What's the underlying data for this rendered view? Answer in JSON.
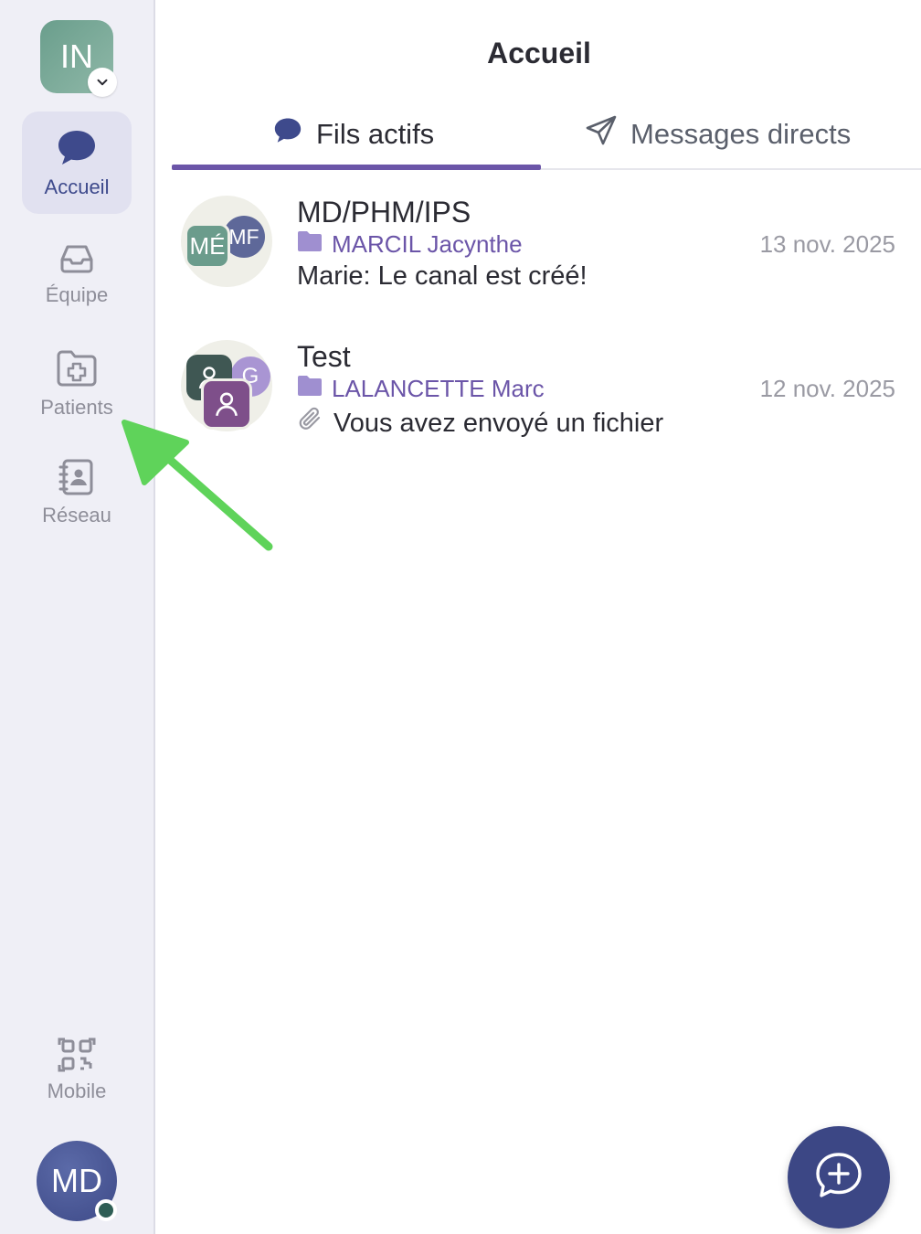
{
  "sidebar": {
    "org_initials": "IN",
    "items": [
      {
        "label": "Accueil",
        "icon": "chat-bubble-icon",
        "active": true
      },
      {
        "label": "Équipe",
        "icon": "inbox-icon",
        "active": false
      },
      {
        "label": "Patients",
        "icon": "folder-plus-icon",
        "active": false
      },
      {
        "label": "Réseau",
        "icon": "contacts-book-icon",
        "active": false
      }
    ],
    "mobile_label": "Mobile",
    "user_initials": "MD"
  },
  "header": {
    "title": "Accueil"
  },
  "tabs": [
    {
      "label": "Fils actifs",
      "icon": "chat-bubble-icon",
      "active": true
    },
    {
      "label": "Messages directs",
      "icon": "send-icon",
      "active": false
    }
  ],
  "threads": [
    {
      "title": "MD/PHM/IPS",
      "patient": "MARCIL Jacynthe",
      "date": "13 nov. 2025",
      "preview": "Marie: Le canal est créé!",
      "avatars": [
        "MÉ",
        "MF"
      ]
    },
    {
      "title": "Test",
      "patient": "LALANCETTE Marc",
      "date": "12 nov. 2025",
      "preview": "Vous avez envoyé un fichier",
      "avatars": [
        "G"
      ]
    }
  ],
  "colors": {
    "accent": "#6b55a8",
    "nav_active": "#3e4a8c",
    "fab": "#3c4785",
    "annotation_arrow": "#5fd35a"
  }
}
